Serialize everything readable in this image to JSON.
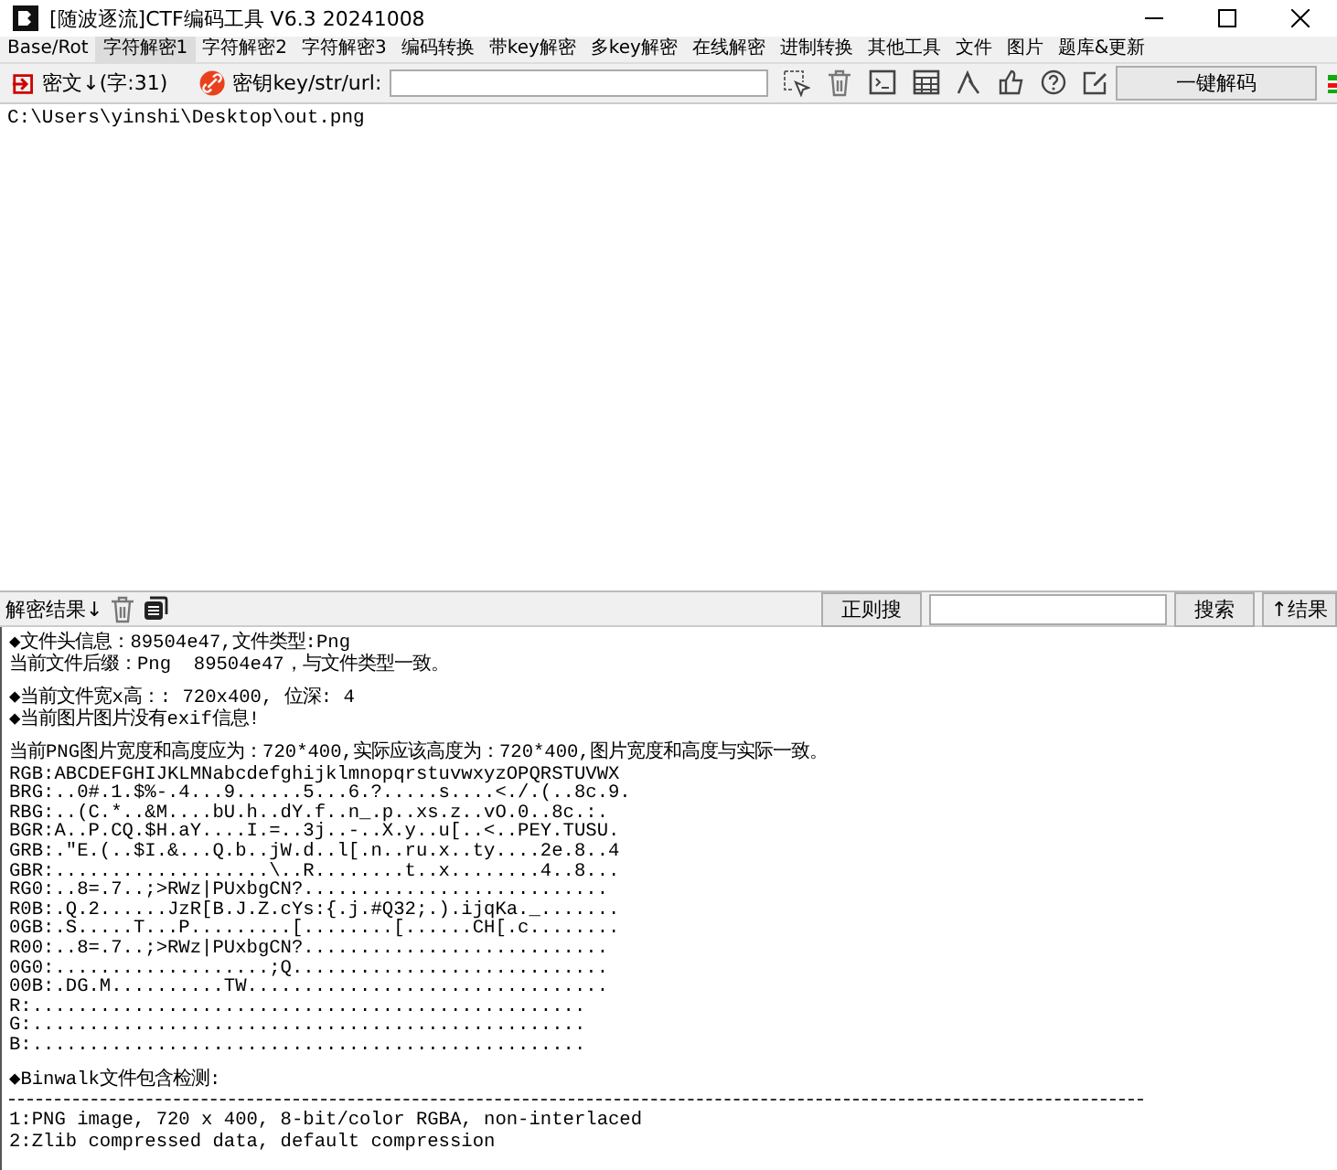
{
  "window": {
    "title": "[随波逐流]CTF编码工具 V6.3 20241008"
  },
  "menu": [
    {
      "label": "Base/Rot",
      "selected": false
    },
    {
      "label": "字符解密1",
      "selected": true
    },
    {
      "label": "字符解密2",
      "selected": false
    },
    {
      "label": "字符解密3",
      "selected": false
    },
    {
      "label": "编码转换",
      "selected": false
    },
    {
      "label": "带key解密",
      "selected": false
    },
    {
      "label": "多key解密",
      "selected": false
    },
    {
      "label": "在线解密",
      "selected": false
    },
    {
      "label": "进制转换",
      "selected": false
    },
    {
      "label": "其他工具",
      "selected": false
    },
    {
      "label": "文件",
      "selected": false
    },
    {
      "label": "图片",
      "selected": false
    },
    {
      "label": "题库&更新",
      "selected": false
    }
  ],
  "toolbar": {
    "cipher_label": "密文↓(字:31)",
    "key_label": "密钥key/str/url:",
    "decode_button": "一键解码"
  },
  "input": {
    "value": "C:\\Users\\yinshi\\Desktop\\out.png"
  },
  "result_bar": {
    "label": "解密结果↓",
    "regex_button": "正则搜",
    "search_button": "搜索",
    "up_button": "↑结果"
  },
  "output": [
    {
      "kind": "text",
      "lines": [
        "◆文件头信息：89504e47,文件类型:Png",
        "当前文件后缀：Png  89504e47，与文件类型一致。"
      ]
    },
    {
      "kind": "text",
      "lines": [
        "◆当前文件宽x高：: 720x400, 位深: 4",
        "◆当前图片图片没有exif信息!"
      ]
    },
    {
      "kind": "text",
      "lines": [
        "当前PNG图片宽度和高度应为：720*400,实际应该高度为：720*400,图片宽度和高度与实际一致。",
        "RGB:ABCDEFGHIJKLMNabcdefghijklmnopqrstuvwxyzOPQRSTUVWX",
        "BRG:..0#.1.$%-.4...9......5...6.?.....s....<./.(..8c.9.",
        "RBG:..(C.*..&M....bU.h..dY.f..n_.p..xs.z..vO.0..8c.:.",
        "BGR:A..P.CQ.$H.aY....I.=..3j..-..X.y..u[..<..PEY.TUSU.",
        "GRB:.\"E.(..$I.&...Q.b..jW.d..l[.n..ru.x..ty....2e.8..4",
        "GBR:...................\\..R........t..x........4..8...",
        "RG0:..8=.7..;>RWz|PUxbgCN?...........................",
        "R0B:.Q.2......JzR[B.J.Z.cYs:{.j.#Q32;.).ijqKa._.......",
        "0GB:.S.....T...P.........[........[......CH[.c........",
        "R00:..8=.7..;>RWz|PUxbgCN?...........................",
        "0G0:...................;Q............................",
        "00B:.DG.M..........TW................................",
        "R:.................................................",
        "G:.................................................",
        "B:................................................."
      ]
    },
    {
      "kind": "text",
      "lines": [
        "◆Binwalk文件包含检测:"
      ]
    },
    {
      "kind": "separator"
    },
    {
      "kind": "text",
      "lines": [
        "1:PNG image, 720 x 400, 8-bit/color RGBA, non-interlaced",
        "2:Zlib compressed data, default compression"
      ]
    }
  ]
}
